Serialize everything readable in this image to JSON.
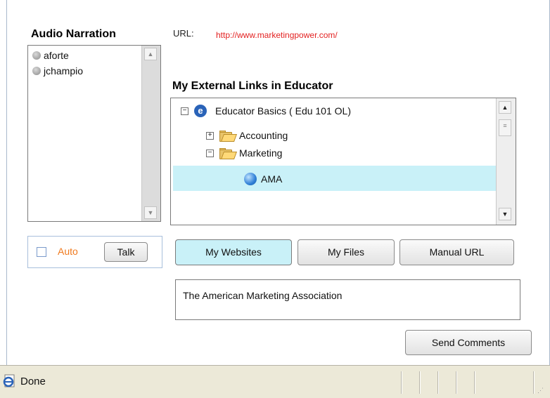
{
  "audio": {
    "heading": "Audio Narration",
    "users": [
      "aforte",
      "jchampio"
    ],
    "auto_label": "Auto",
    "talk_label": "Talk"
  },
  "url": {
    "label": "URL:",
    "value": "http://www.marketingpower.com/"
  },
  "links": {
    "heading": "My External Links in Educator",
    "tree": [
      {
        "label": "Educator Basics  ( Edu 101 OL)",
        "level": 0,
        "expander": "minus",
        "icon": "educator-icon"
      },
      {
        "label": "Accounting",
        "level": 1,
        "expander": "plus",
        "icon": "folder-icon"
      },
      {
        "label": "Marketing",
        "level": 1,
        "expander": "minus",
        "icon": "folder-icon"
      },
      {
        "label": "AMA",
        "level": 2,
        "expander": "",
        "icon": "globe-icon",
        "selected": true
      }
    ]
  },
  "tabs": {
    "websites": "My Websites",
    "files": "My Files",
    "manual": "Manual URL"
  },
  "comment": {
    "text": "The American Marketing Association",
    "send_label": "Send Comments"
  },
  "statusbar": {
    "text": "Done"
  },
  "colors": {
    "url": "#e32222",
    "auto": "#f07a1e",
    "selected_row": "#c9f1f8",
    "active_tab": "#c9f1f8"
  }
}
